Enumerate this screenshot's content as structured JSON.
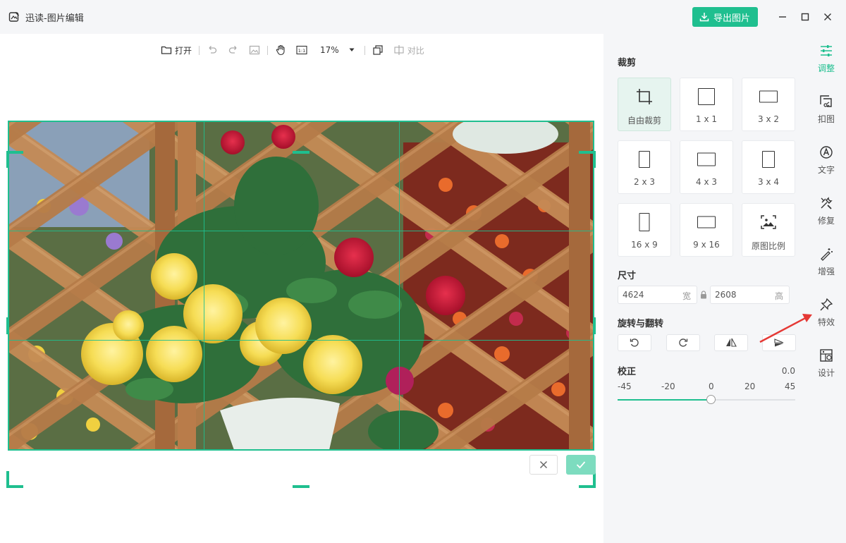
{
  "window": {
    "title": "迅读-图片编辑",
    "export_label": "导出图片",
    "accent": "#1fbf8f"
  },
  "toolbar": {
    "open_label": "打开",
    "zoom": "17%",
    "compare_label": "对比",
    "ratio_label": "1:1"
  },
  "crop": {
    "section_title": "裁剪",
    "options": [
      {
        "label": "自由裁剪",
        "icon": "crop-icon",
        "active": true
      },
      {
        "label": "1 x 1",
        "icon": "square-icon"
      },
      {
        "label": "3 x 2",
        "icon": "landscape-icon"
      },
      {
        "label": "2 x 3",
        "icon": "portrait-icon"
      },
      {
        "label": "4 x 3",
        "icon": "landscape-icon"
      },
      {
        "label": "3 x 4",
        "icon": "portrait-icon"
      },
      {
        "label": "16 x 9",
        "icon": "tall-icon"
      },
      {
        "label": "9 x 16",
        "icon": "wide-icon"
      },
      {
        "label": "原图比例",
        "icon": "image-icon"
      }
    ]
  },
  "size": {
    "section_title": "尺寸",
    "width": "4624",
    "width_unit": "宽",
    "height": "2608",
    "height_unit": "高"
  },
  "rotate": {
    "section_title": "旋转与翻转"
  },
  "correct": {
    "section_title": "校正",
    "value": "0.0",
    "ticks": [
      "-45",
      "-20",
      "0",
      "20",
      "45"
    ],
    "slider_fraction": 0.525
  },
  "sidetabs": [
    {
      "label": "调整",
      "icon": "sliders-icon",
      "active": true
    },
    {
      "label": "扣图",
      "icon": "cutout-icon"
    },
    {
      "label": "文字",
      "icon": "text-icon"
    },
    {
      "label": "修复",
      "icon": "repair-icon"
    },
    {
      "label": "增强",
      "icon": "magic-wand-icon"
    },
    {
      "label": "特效",
      "icon": "effects-pin-icon"
    },
    {
      "label": "设计",
      "icon": "design-icon"
    }
  ]
}
